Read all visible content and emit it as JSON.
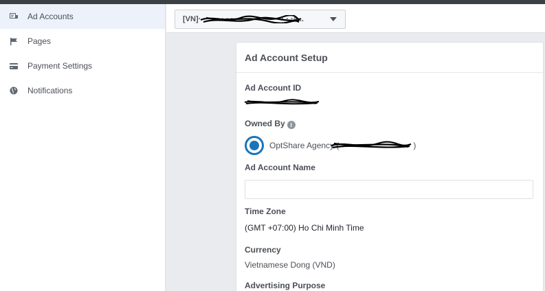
{
  "sidebar": {
    "items": [
      {
        "label": "Ad Accounts",
        "icon": "ad-accounts-icon",
        "active": true
      },
      {
        "label": "Pages",
        "icon": "flag-icon",
        "active": false
      },
      {
        "label": "Payment Settings",
        "icon": "credit-card-icon",
        "active": false
      },
      {
        "label": "Notifications",
        "icon": "globe-icon",
        "active": false
      }
    ]
  },
  "account_selector": {
    "prefix": "[VN]",
    "trailing": "a...",
    "caret_icon": "caret-down-icon"
  },
  "card": {
    "title": "Ad Account Setup",
    "ad_account_id_label": "Ad Account ID",
    "owned_by_label": "Owned By",
    "owned_by_info_icon": "info-icon",
    "owner_name": "OptShare Agency (",
    "owner_suffix": ")",
    "ad_account_name_label": "Ad Account Name",
    "ad_account_name_value": "",
    "time_zone_label": "Time Zone",
    "time_zone_value": "(GMT +07:00) Ho Chi Minh Time",
    "currency_label": "Currency",
    "currency_value": "Vietnamese Dong (VND)",
    "advertising_purpose_label": "Advertising Purpose"
  },
  "colors": {
    "accent": "#1a74b9",
    "active_bg": "#edf2fa",
    "redaction": "#000000"
  }
}
